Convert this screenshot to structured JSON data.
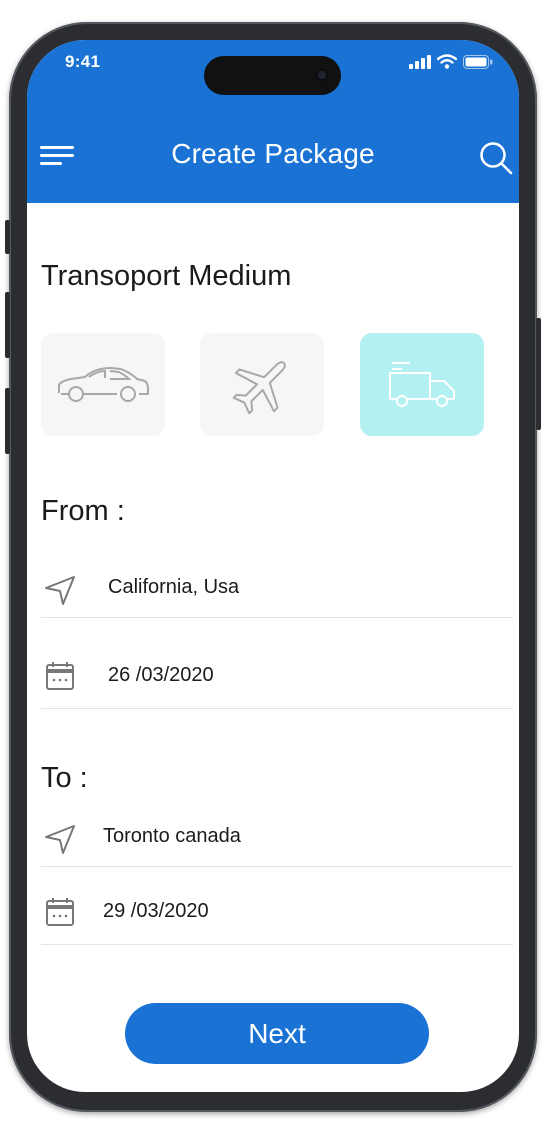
{
  "status_bar": {
    "time": "9:41"
  },
  "header": {
    "title": "Create Package"
  },
  "transport": {
    "heading": "Transoport Medium",
    "options": [
      {
        "icon": "car-icon",
        "selected": false
      },
      {
        "icon": "airplane-icon",
        "selected": false
      },
      {
        "icon": "truck-icon",
        "selected": true
      }
    ]
  },
  "from": {
    "heading": "From :",
    "location": "California, Usa",
    "date": "26 /03/2020"
  },
  "to": {
    "heading": "To :",
    "location": "Toronto canada",
    "date": "29 /03/2020"
  },
  "actions": {
    "next_label": "Next"
  },
  "colors": {
    "primary": "#1a73d4",
    "selected_tile": "#b3f0f2",
    "tile": "#f6f6f6"
  }
}
